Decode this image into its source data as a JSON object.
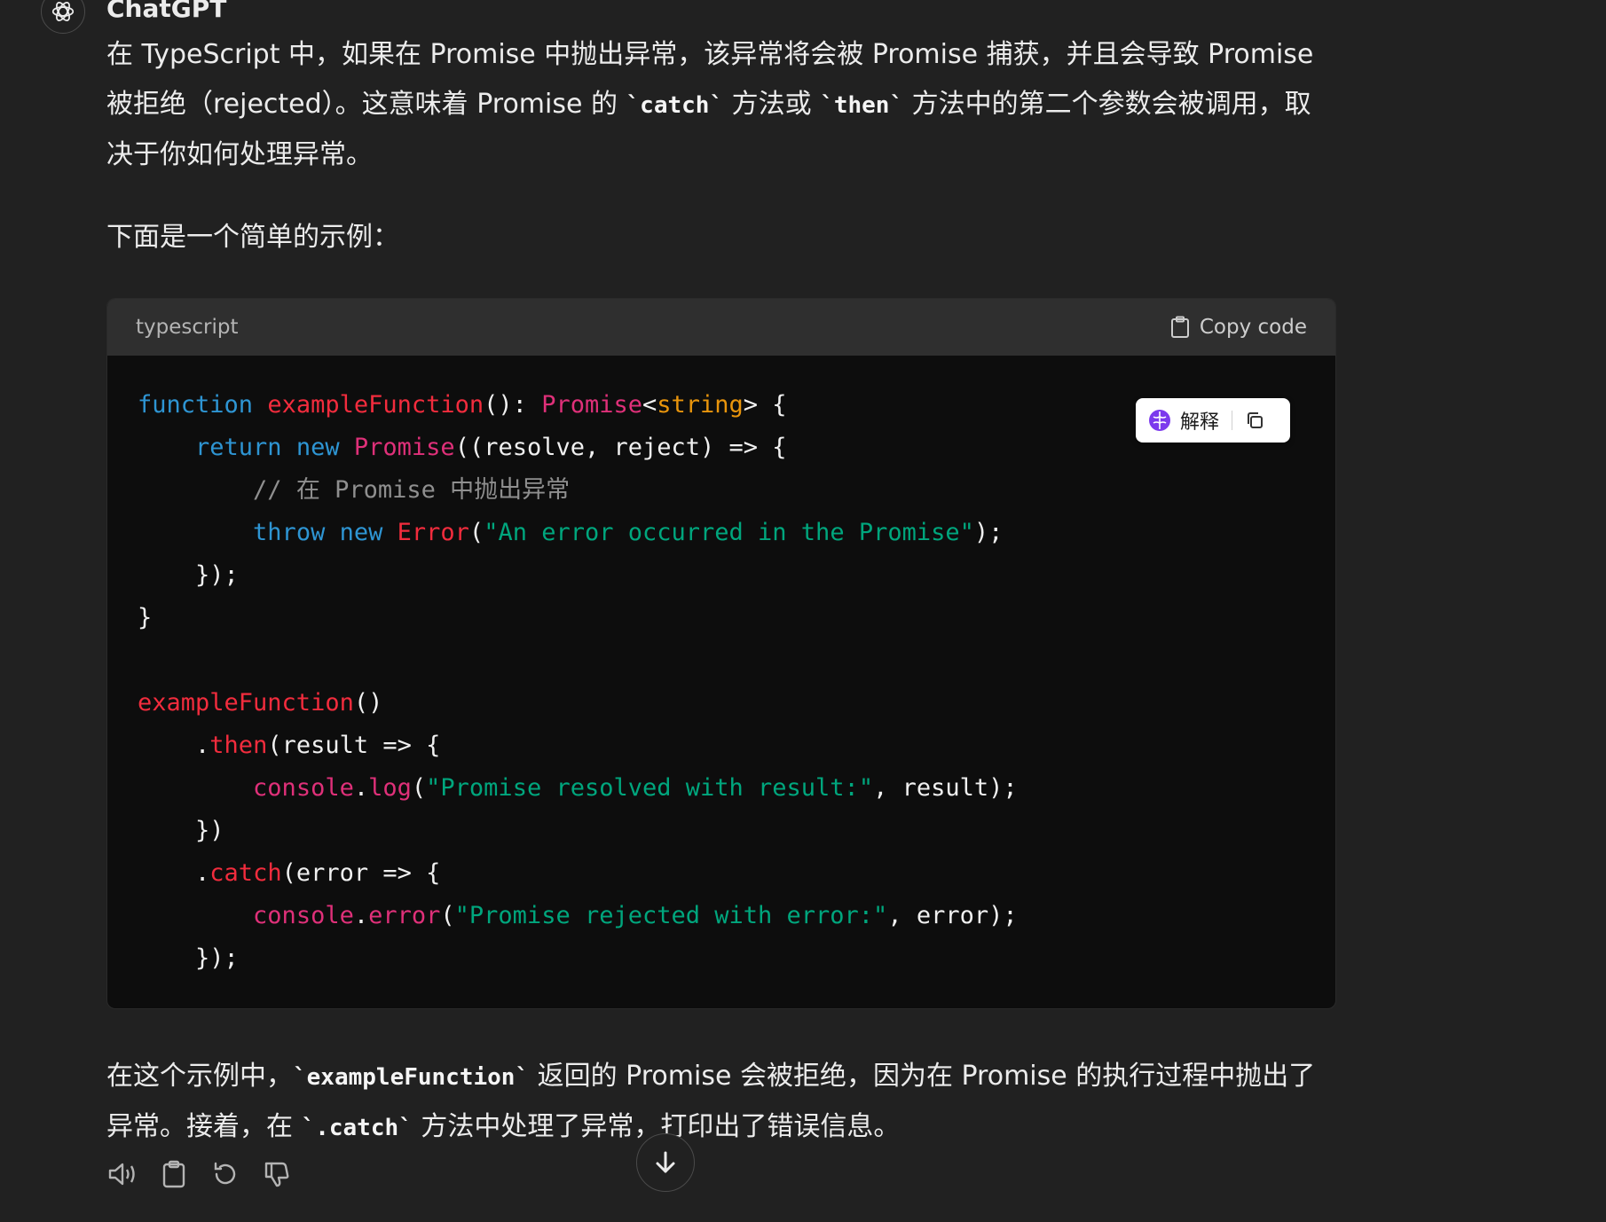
{
  "message": {
    "author": "ChatGPT",
    "p1": {
      "t1": "在 TypeScript 中，如果在 Promise 中抛出异常，该异常将会被 Promise 捕获，并且会导致 Promise 被拒绝（rejected）。这意味着 Promise 的 ",
      "c1": "`catch`",
      "t2": " 方法或 ",
      "c2": "`then`",
      "t3": " 方法中的第二个参数会被调用，取决于你如何处理异常。"
    },
    "p2": "下面是一个简单的示例：",
    "p3": {
      "t1": "在这个示例中，",
      "c1": "`exampleFunction`",
      "t2": " 返回的 Promise 会被拒绝，因为在 Promise 的执行过程中抛出了异常。接着，在 ",
      "c2": "`.catch`",
      "t3": " 方法中处理了异常，打印出了错误信息。"
    }
  },
  "code_block": {
    "language": "typescript",
    "copy_label": "Copy code",
    "tokens": {
      "l1_kw": "function",
      "l1_fn": "exampleFunction",
      "l1_a": "(): ",
      "l1_ty": "Promise",
      "l1_b": "<",
      "l1_tp": "string",
      "l1_c": "> {",
      "l2_kw1": "return",
      "l2_kw2": "new",
      "l2_ty": "Promise",
      "l2_a": "((resolve, reject) => {",
      "l3_cm": "// 在 Promise 中抛出异常",
      "l4_kw1": "throw",
      "l4_kw2": "new",
      "l4_ty": "Error",
      "l4_a": "(",
      "l4_st": "\"An error occurred in the Promise\"",
      "l4_b": ");",
      "l5": "});",
      "l6": "}",
      "l8_fn": "exampleFunction",
      "l8_a": "()",
      "l9_a": ".",
      "l9_fn": "then",
      "l9_b": "(result => {",
      "l10_ty1": "console",
      "l10_a": ".",
      "l10_ty2": "log",
      "l10_b": "(",
      "l10_st": "\"Promise resolved with result:\"",
      "l10_c": ", result);",
      "l11": "})",
      "l12_a": ".",
      "l12_fn": "catch",
      "l12_b": "(error => {",
      "l13_ty1": "console",
      "l13_a": ".",
      "l13_ty2": "error",
      "l13_b": "(",
      "l13_st": "\"Promise rejected with error:\"",
      "l13_c": ", error);",
      "l14": "});"
    }
  },
  "explain_widget": {
    "label": "解释"
  },
  "icons": {
    "avatar": "openai-logo-icon",
    "copy": "clipboard-icon",
    "explain": "brain-icon",
    "explain_copy": "copy-icon",
    "read_aloud": "speaker-icon",
    "copy_message": "clipboard-icon",
    "regenerate": "refresh-icon",
    "dislike": "thumbs-down-icon",
    "scroll": "arrow-down-icon"
  },
  "colors": {
    "background": "#212121",
    "code_background": "#0d0d0d",
    "code_header": "#2f2f2f",
    "keyword": "#2e95d3",
    "function": "#f22c3d",
    "type": "#df3079",
    "type_param": "#e9950c",
    "string": "#00a67d",
    "comment": "#8f8f8f",
    "brain_icon": "#7c3aed"
  }
}
